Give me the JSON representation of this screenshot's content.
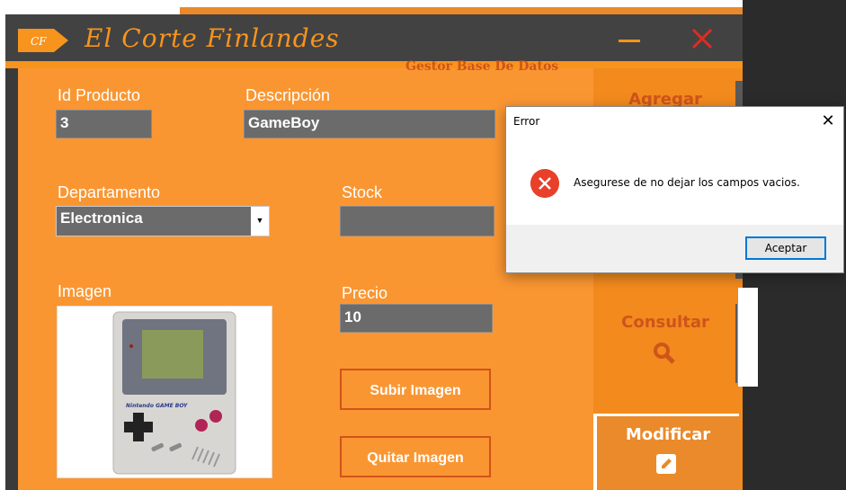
{
  "app": {
    "logo_text": "CF",
    "title": "El Corte Finlandes",
    "subtitle": "Gestor Base De Datos",
    "colors": {
      "accent": "#f7941d",
      "close": "#e02b20",
      "titlebar": "#424242"
    }
  },
  "form": {
    "id_label": "Id Producto",
    "id_value": "3",
    "desc_label": "Descripción",
    "desc_value": "GameBoy",
    "dept_label": "Departamento",
    "dept_value": "Electronica",
    "stock_label": "Stock",
    "stock_value": "",
    "image_label": "Imagen",
    "price_label": "Precio",
    "price_value": "10",
    "upload_button": "Subir Imagen",
    "remove_button": "Quitar Imagen"
  },
  "product_image": {
    "brand_text": "Nintendo GAME BOY"
  },
  "sidebar": {
    "add_label": "Agregar",
    "query_label": "Consultar",
    "modify_label": "Modificar"
  },
  "dialog": {
    "title": "Error",
    "message": "Asegurese de no dejar los campos vacios.",
    "button": "Aceptar",
    "close_glyph": "✕"
  }
}
